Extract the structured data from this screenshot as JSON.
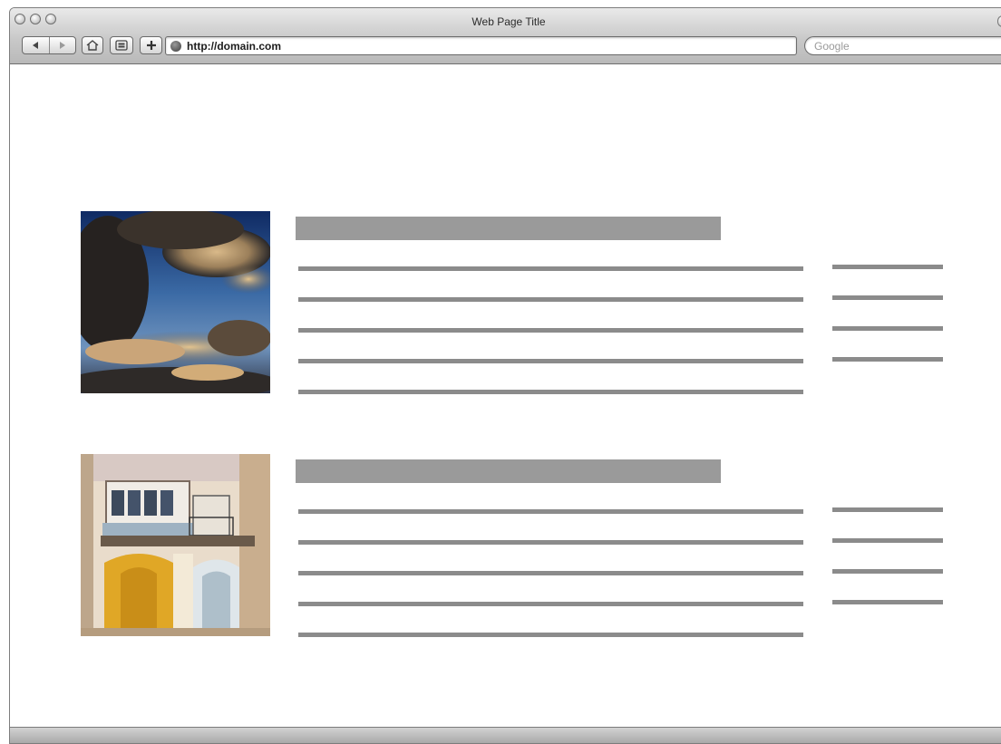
{
  "window": {
    "title": "Web Page Title"
  },
  "toolbar": {
    "back_icon": "back-arrow-icon",
    "forward_icon": "forward-arrow-icon",
    "home_icon": "home-icon",
    "bookmarks_icon": "bookmarks-icon",
    "add_icon": "plus-icon",
    "site_icon": "globe-icon"
  },
  "address": {
    "url": "http://domain.com"
  },
  "search": {
    "placeholder": "Google"
  },
  "content": {
    "items": [
      {
        "image": "sky-clouds-photo"
      },
      {
        "image": "building-balcony-photo"
      }
    ]
  },
  "colors": {
    "placeholder_bar": "#9a9a9a",
    "text_line": "#8b8b8b"
  }
}
